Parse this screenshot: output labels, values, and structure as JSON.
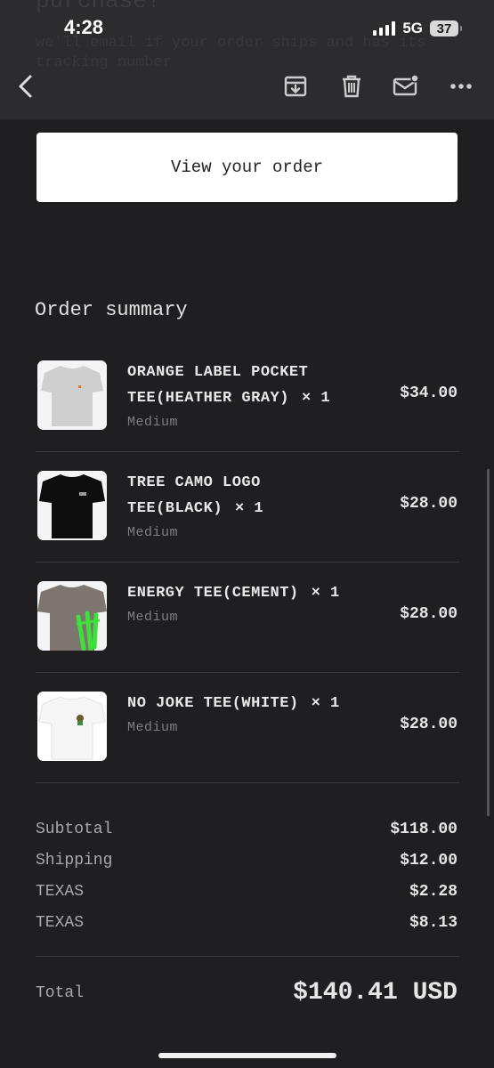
{
  "status_bar": {
    "time": "4:28",
    "network": "5G",
    "battery": "37"
  },
  "header": {
    "ghost_title": "purchase!",
    "ghost_subtitle": "we'll email if your order ships and has its tracking number",
    "icons": [
      "back-icon",
      "archive-icon",
      "trash-icon",
      "mail-icon",
      "more-icon"
    ]
  },
  "view_order_label": "View your order",
  "summary": {
    "title": "Order summary",
    "items": [
      {
        "name": "ORANGE LABEL POCKET TEE(HEATHER GRAY)",
        "qty": "× 1",
        "variant": "Medium",
        "price": "$34.00",
        "thumb": "heather-gray-tee"
      },
      {
        "name": "TREE CAMO LOGO TEE(BLACK)",
        "qty": "× 1",
        "variant": "Medium",
        "price": "$28.00",
        "thumb": "black-tee"
      },
      {
        "name": "ENERGY TEE(CEMENT)",
        "qty": "× 1",
        "variant": "Medium",
        "price": "$28.00",
        "thumb": "cement-tee"
      },
      {
        "name": "NO JOKE TEE(WHITE)",
        "qty": "× 1",
        "variant": "Medium",
        "price": "$28.00",
        "thumb": "white-tee"
      }
    ]
  },
  "totals": {
    "rows": [
      {
        "label": "Subtotal",
        "value": "$118.00"
      },
      {
        "label": "Shipping",
        "value": "$12.00"
      },
      {
        "label": "TEXAS",
        "value": "$2.28"
      },
      {
        "label": "TEXAS",
        "value": "$8.13"
      }
    ],
    "total_label": "Total",
    "total_value": "$140.41 USD"
  },
  "colors": {
    "background": "#1f1f21",
    "topbar": "#2c2c2e",
    "button": "#ffffff",
    "accent_green": "#3ee03a"
  }
}
